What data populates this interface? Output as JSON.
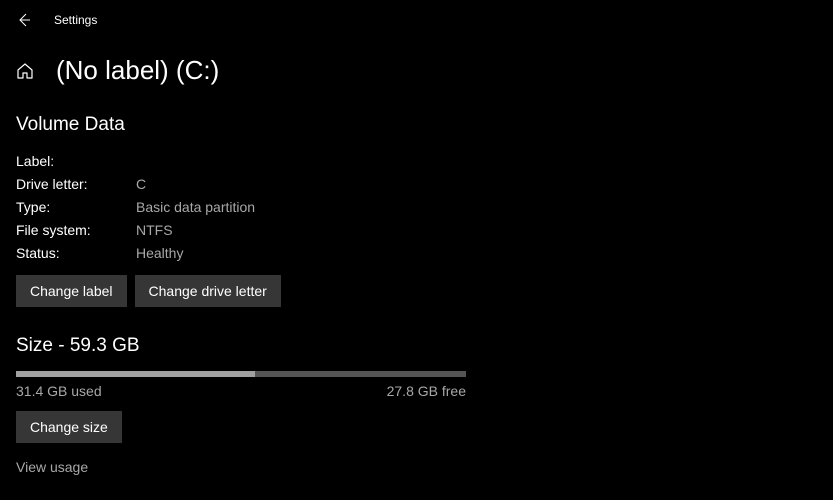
{
  "header": {
    "window_title": "Settings"
  },
  "page": {
    "title": "(No label) (C:)"
  },
  "volume": {
    "heading": "Volume Data",
    "fields": {
      "label_key": "Label:",
      "label_val": "",
      "drive_letter_key": "Drive letter:",
      "drive_letter_val": "C",
      "type_key": "Type:",
      "type_val": "Basic data partition",
      "file_system_key": "File system:",
      "file_system_val": "NTFS",
      "status_key": "Status:",
      "status_val": "Healthy"
    },
    "buttons": {
      "change_label": "Change label",
      "change_drive_letter": "Change drive letter"
    }
  },
  "size": {
    "heading": "Size - 59.3 GB",
    "total_gb": 59.3,
    "used_gb": 31.4,
    "free_gb": 27.8,
    "used_label": "31.4 GB used",
    "free_label": "27.8 GB free",
    "used_percent": 53,
    "change_size": "Change size",
    "view_usage": "View usage"
  }
}
